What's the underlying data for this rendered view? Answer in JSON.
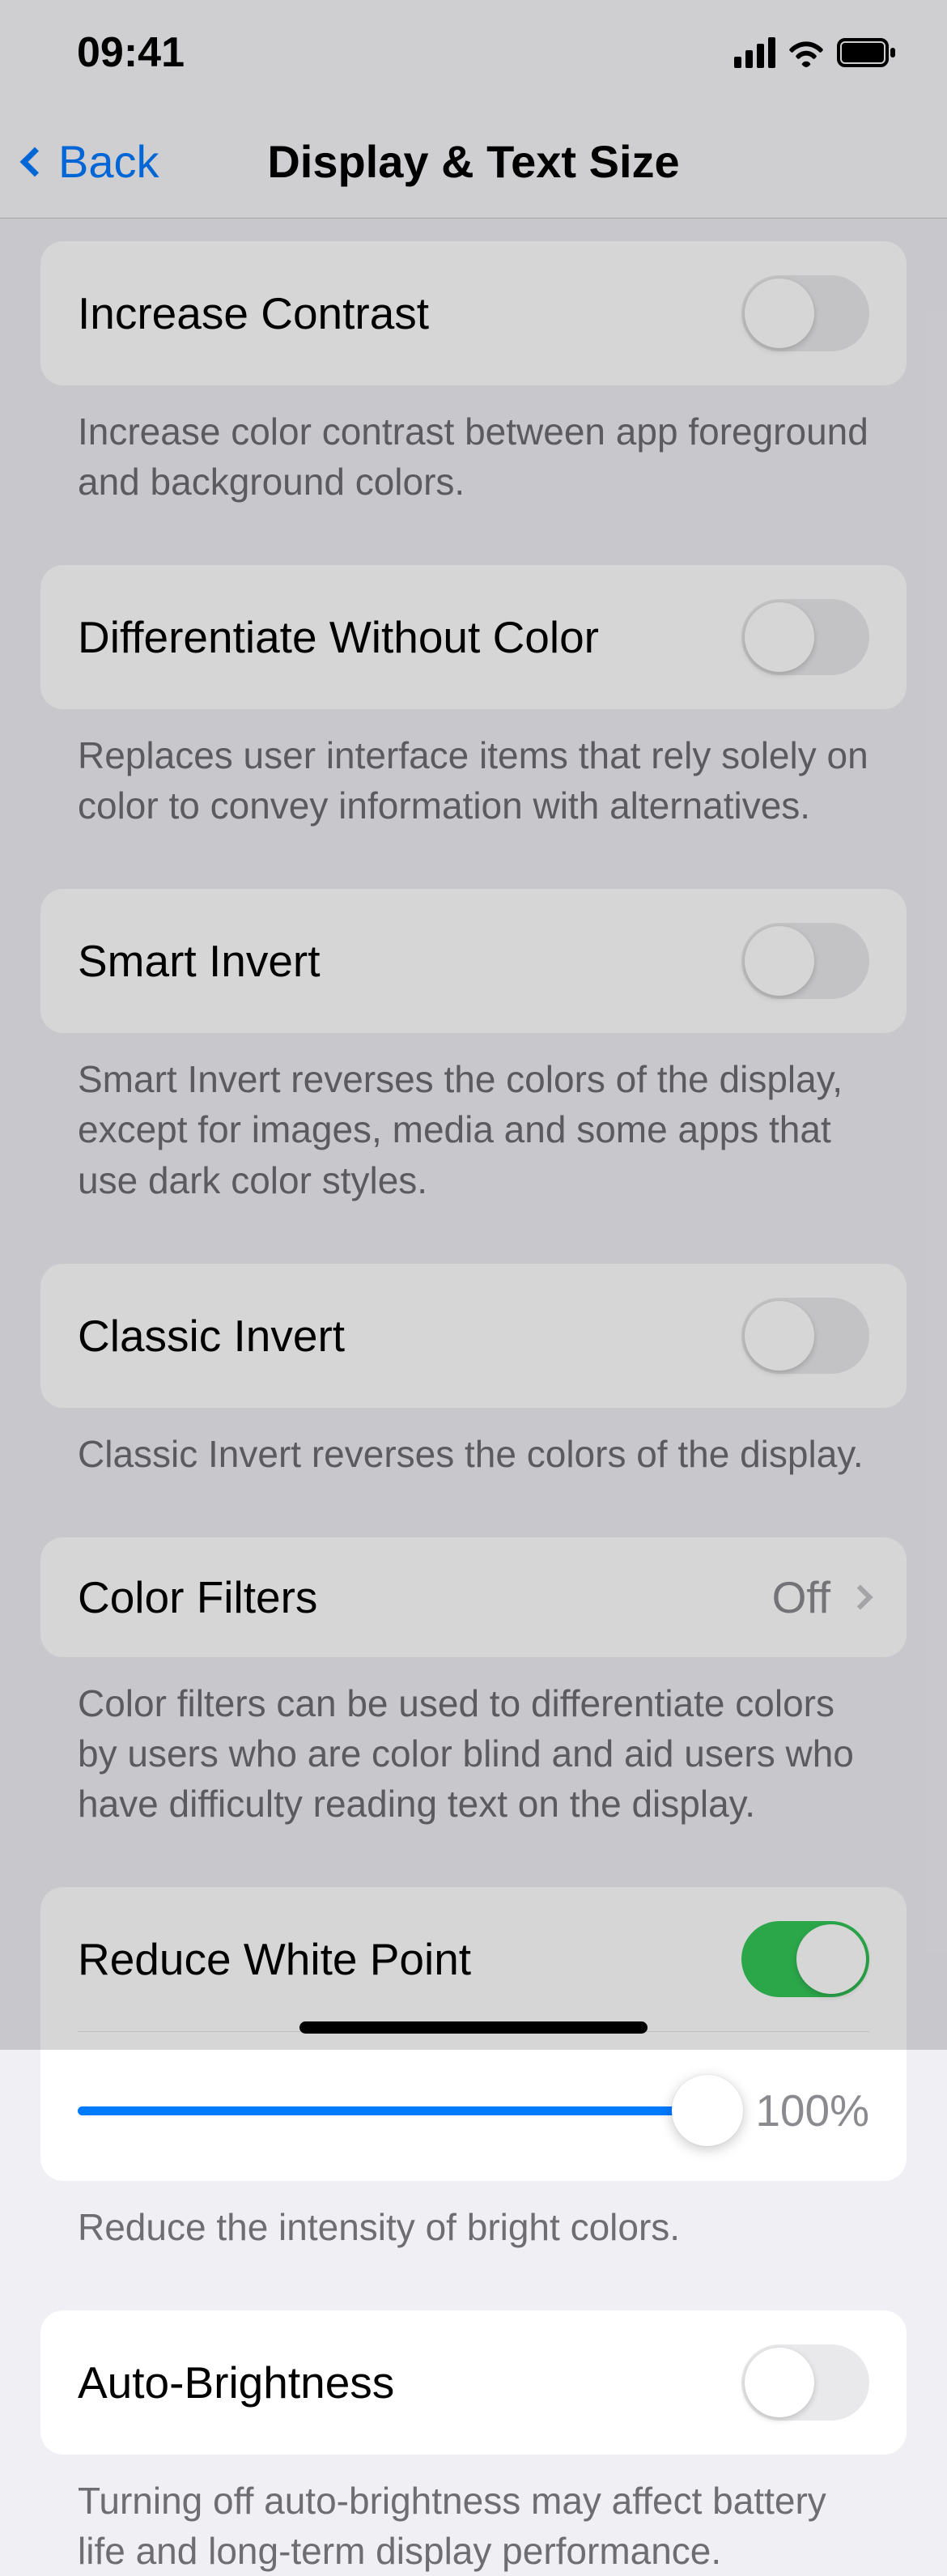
{
  "status": {
    "time": "09:41"
  },
  "nav": {
    "back": "Back",
    "title": "Display & Text Size"
  },
  "settings": {
    "increase_contrast": {
      "label": "Increase Contrast",
      "on": false,
      "note": "Increase color contrast between app foreground and background colors."
    },
    "differentiate_without_color": {
      "label": "Differentiate Without Color",
      "on": false,
      "note": "Replaces user interface items that rely solely on color to convey information with alternatives."
    },
    "smart_invert": {
      "label": "Smart Invert",
      "on": false,
      "note": "Smart Invert reverses the colors of the display, except for images, media and some apps that use dark color styles."
    },
    "classic_invert": {
      "label": "Classic Invert",
      "on": false,
      "note": "Classic Invert reverses the colors of the display."
    },
    "color_filters": {
      "label": "Color Filters",
      "value": "Off",
      "note": "Color filters can be used to differentiate colors by users who are color blind and aid users who have difficulty reading text on the display."
    },
    "reduce_white_point": {
      "label": "Reduce White Point",
      "on": true,
      "slider_value": "100%",
      "note": "Reduce the intensity of bright colors."
    },
    "auto_brightness": {
      "label": "Auto-Brightness",
      "on": false,
      "note": "Turning off auto-brightness may affect battery life and long-term display performance."
    }
  }
}
